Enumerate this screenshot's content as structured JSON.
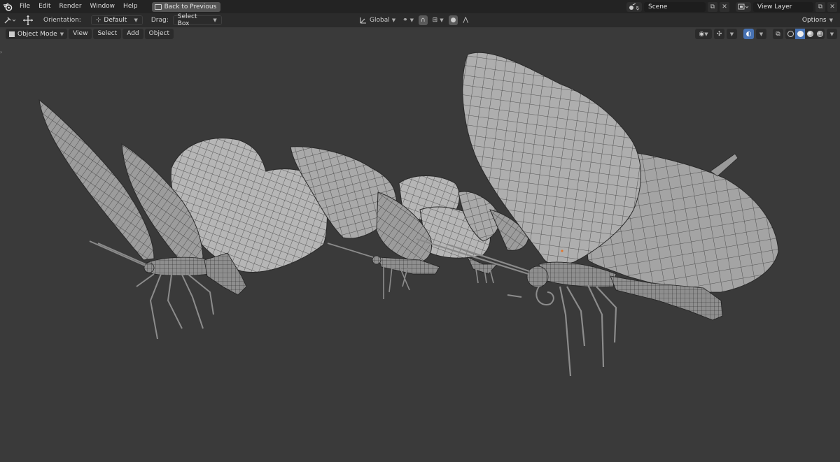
{
  "app": {
    "menu": [
      "File",
      "Edit",
      "Render",
      "Window",
      "Help"
    ],
    "back_label": "Back to Previous",
    "scene_name": "Scene",
    "view_layer": "View Layer"
  },
  "toolbar": {
    "orientation_label": "Orientation:",
    "orientation_value": "Default",
    "drag_label": "Drag:",
    "drag_value": "Select Box",
    "transform_space": "Global",
    "options_label": "Options"
  },
  "viewport": {
    "mode": "Object Mode",
    "menus": [
      "View",
      "Select",
      "Add",
      "Object"
    ]
  },
  "colors": {
    "accent": "#4772b3",
    "background": "#3a3a3a",
    "mesh_fill": "#b4b4b4",
    "wire": "#2a2a2a"
  }
}
